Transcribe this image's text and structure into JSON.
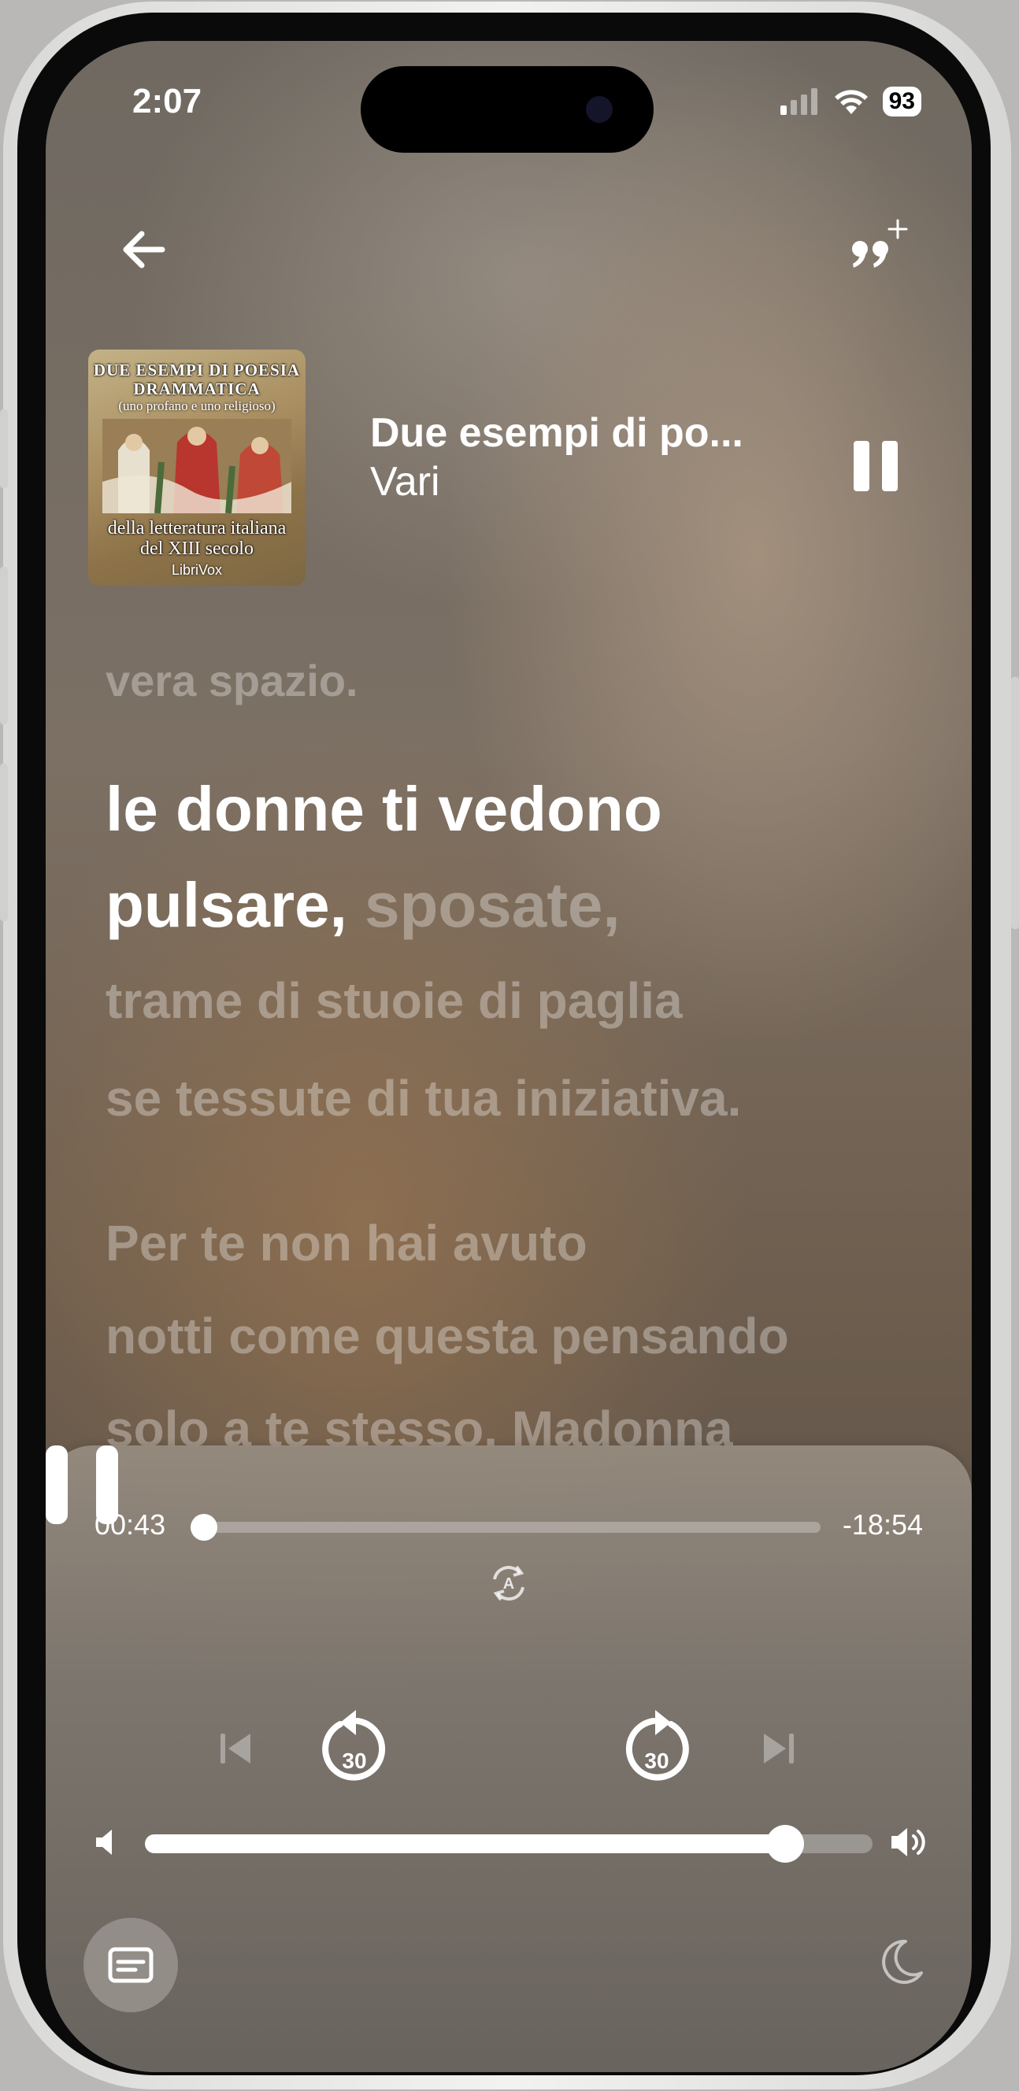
{
  "status_bar": {
    "time": "2:07",
    "battery": "93"
  },
  "header": {
    "back_icon": "arrow-left-icon",
    "quote_icon": "quote-plus-icon"
  },
  "now_playing": {
    "title": "Due esempi di po...",
    "author": "Vari",
    "cover": {
      "title": "DUE ESEMPI DI POESIA DRAMMATICA",
      "subtitle": "(uno profano e uno religioso)",
      "bottom_line1": "della letteratura italiana",
      "bottom_line2": "del XIII secolo",
      "logo": "LibriVox"
    }
  },
  "lyrics": {
    "line_prev": "vera spazio.",
    "current_active": "le donne ti vedono",
    "current_active_2": "pulsare,",
    "current_rest": "sposate,",
    "line_next_1": "trame di stuoie di paglia",
    "line_next_2": "se tessute di tua iniziativa.",
    "para2_line1": "Per te non hai avuto",
    "para2_line2": "notti come questa pensando",
    "para2_line3": "solo a te stesso. Madonna"
  },
  "player": {
    "elapsed": "00:43",
    "remaining": "-18:54",
    "progress_fraction": 0.02,
    "volume_fraction": 0.88,
    "rewind_seconds": "30",
    "forward_seconds": "30",
    "autoplay_icon_label": "A"
  }
}
